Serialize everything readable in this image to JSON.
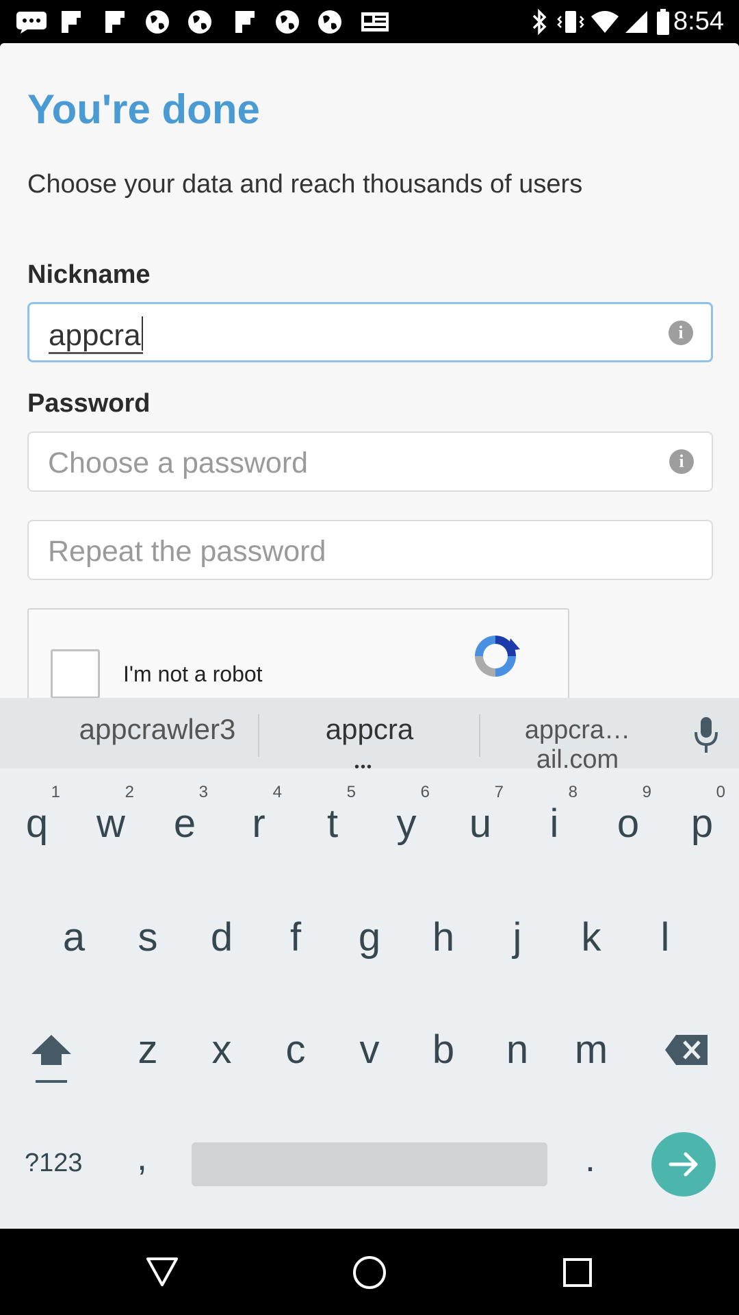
{
  "status_bar": {
    "time": "8:54",
    "icons": [
      "chat-icon",
      "flipboard-icon",
      "flipboard-icon",
      "globe-icon",
      "globe-icon",
      "flipboard-icon",
      "globe-icon",
      "globe-icon",
      "newspaper-icon",
      "bluetooth-icon",
      "vibrate-icon",
      "wifi-icon",
      "signal-icon",
      "battery-icon"
    ]
  },
  "form": {
    "title": "You're done",
    "subtitle": "Choose your data and reach thousands of users",
    "nickname_label": "Nickname",
    "nickname_value": "appcra",
    "password_label": "Password",
    "password_placeholder": "Choose a password",
    "repeat_placeholder": "Repeat the password",
    "captcha_label": "I'm not a robot"
  },
  "keyboard": {
    "suggestions": [
      "appcrawler3",
      "appcra",
      "appcra…ail.com"
    ],
    "row1": [
      {
        "k": "q",
        "h": "1"
      },
      {
        "k": "w",
        "h": "2"
      },
      {
        "k": "e",
        "h": "3"
      },
      {
        "k": "r",
        "h": "4"
      },
      {
        "k": "t",
        "h": "5"
      },
      {
        "k": "y",
        "h": "6"
      },
      {
        "k": "u",
        "h": "7"
      },
      {
        "k": "i",
        "h": "8"
      },
      {
        "k": "o",
        "h": "9"
      },
      {
        "k": "p",
        "h": "0"
      }
    ],
    "row2": [
      "a",
      "s",
      "d",
      "f",
      "g",
      "h",
      "j",
      "k",
      "l"
    ],
    "row3": [
      "z",
      "x",
      "c",
      "v",
      "b",
      "n",
      "m"
    ],
    "symbols_label": "?123",
    "comma": ",",
    "period": "."
  },
  "colors": {
    "accent": "#4a9ad4",
    "go_button": "#4db6ac",
    "keyboard_bg": "#eceff1"
  }
}
